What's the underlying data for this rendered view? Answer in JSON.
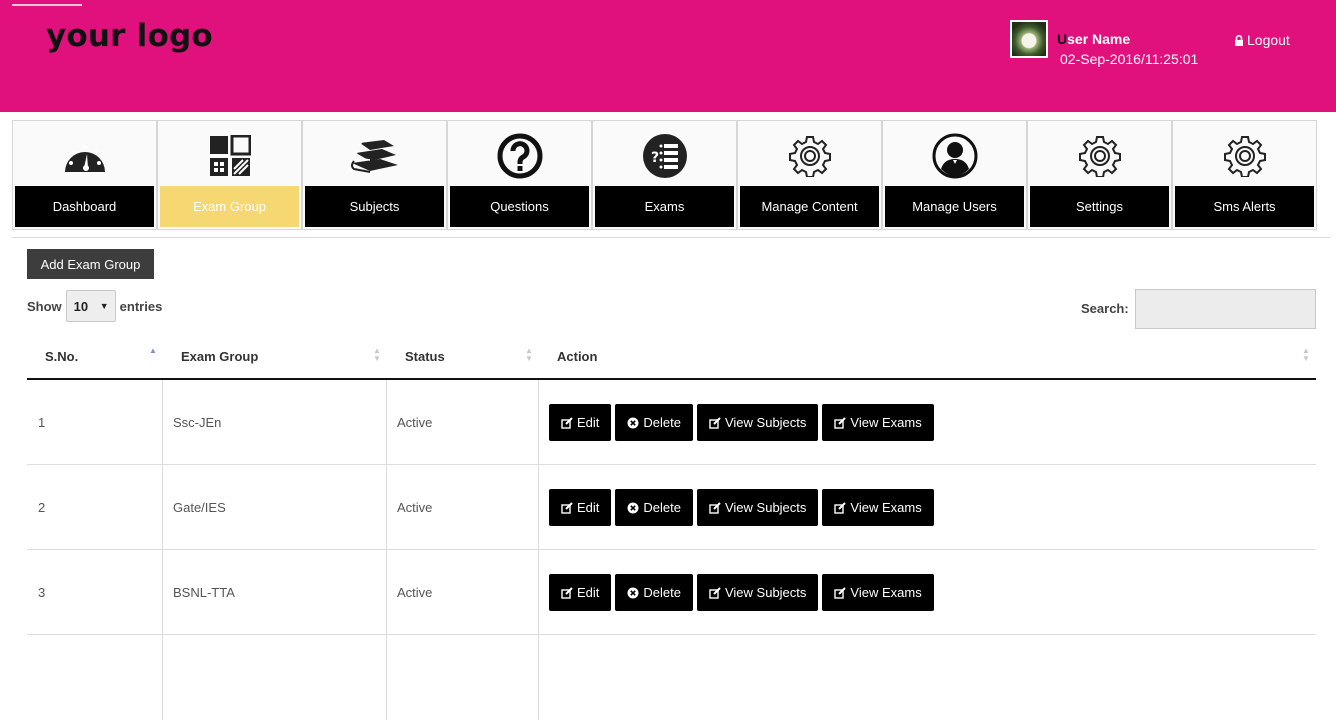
{
  "header": {
    "logo": "your logo",
    "user_name": "User Name",
    "datetime": "02-Sep-2016/11:25:01",
    "logout_label": "Logout"
  },
  "nav": {
    "items": [
      {
        "label": "Dashboard",
        "icon": "dashboard-gauge-icon"
      },
      {
        "label": "Exam Group",
        "icon": "grid-icon",
        "active": true
      },
      {
        "label": "Subjects",
        "icon": "books-icon"
      },
      {
        "label": "Questions",
        "icon": "question-icon"
      },
      {
        "label": "Exams",
        "icon": "exam-list-icon"
      },
      {
        "label": "Manage Content",
        "icon": "gear-icon"
      },
      {
        "label": "Manage Users",
        "icon": "user-icon"
      },
      {
        "label": "Settings",
        "icon": "gear-icon"
      },
      {
        "label": "Sms Alerts",
        "icon": "gear-icon"
      }
    ]
  },
  "toolbar": {
    "add_label": "Add Exam Group",
    "show_label": "Show",
    "entries_value": "10",
    "entries_label": "entries",
    "search_label": "Search:",
    "search_value": ""
  },
  "table": {
    "columns": [
      "S.No.",
      "Exam Group",
      "Status",
      "Action"
    ],
    "rows": [
      {
        "sno": "1",
        "group": "Ssc-JEn",
        "status": "Active"
      },
      {
        "sno": "2",
        "group": "Gate/IES",
        "status": "Active"
      },
      {
        "sno": "3",
        "group": "BSNL-TTA",
        "status": "Active"
      }
    ],
    "actions": {
      "edit": "Edit",
      "delete": "Delete",
      "view_subjects": "View Subjects",
      "view_exams": "View Exams"
    }
  },
  "colors": {
    "header_bg": "#e0117d",
    "active_tab": "#f5d872",
    "tab_label_bg": "#000000"
  }
}
